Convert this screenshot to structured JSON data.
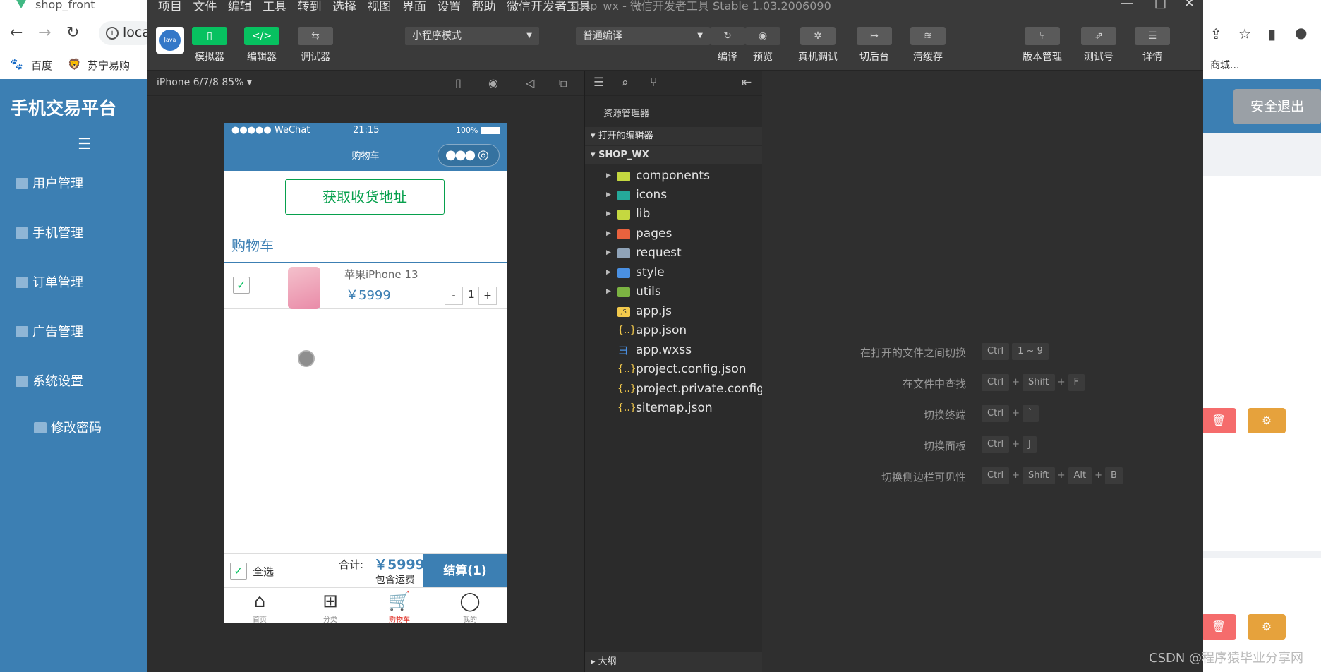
{
  "browser": {
    "tab_title": "shop_front",
    "address": "loca",
    "bookmarks": [
      "百度",
      "苏宁易购"
    ],
    "right_bookmark": "商城..."
  },
  "admin": {
    "title": "手机交易平台",
    "menu": [
      "用户管理",
      "手机管理",
      "订单管理",
      "广告管理",
      "系统设置"
    ],
    "submenu": "修改密码",
    "logout": "安全退出"
  },
  "devtools": {
    "menu": [
      "项目",
      "文件",
      "编辑",
      "工具",
      "转到",
      "选择",
      "视图",
      "界面",
      "设置",
      "帮助",
      "微信开发者工具"
    ],
    "window_title": "shop_wx - 微信开发者工具 Stable 1.03.2006090",
    "toolbar_left": [
      "模拟器",
      "编辑器",
      "调试器"
    ],
    "mode_select": "小程序模式",
    "compile_select": "普通编译",
    "toolbar_right": [
      "编译",
      "预览",
      "真机调试",
      "切后台",
      "清缓存",
      "版本管理",
      "测试号",
      "详情"
    ],
    "avatar_text": "Java"
  },
  "simulator": {
    "device": "iPhone 6/7/8 85%",
    "status_carrier": "●●●●● WeChat",
    "status_time": "21:15",
    "status_battery": "100%",
    "nav_title": "购物车",
    "address_button": "获取收货地址",
    "section_title": "购物车",
    "item_name": "苹果iPhone 13",
    "item_price": "￥5999",
    "qty_minus": "-",
    "qty": "1",
    "qty_plus": "+",
    "select_all": "全选",
    "total_label": "合计:",
    "total_value": "￥5999",
    "shipping": "包含运费",
    "checkout": "结算(1)",
    "tabs": [
      "首页",
      "分类",
      "购物车",
      "我的"
    ]
  },
  "explorer": {
    "title": "资源管理器",
    "open_editors": "打开的编辑器",
    "project": "SHOP_WX",
    "folders": [
      {
        "name": "components",
        "color": "#c5d840"
      },
      {
        "name": "icons",
        "color": "#25a99a"
      },
      {
        "name": "lib",
        "color": "#c5d840"
      },
      {
        "name": "pages",
        "color": "#e9623e"
      },
      {
        "name": "request",
        "color": "#8fa3b8"
      },
      {
        "name": "style",
        "color": "#4a90e2"
      },
      {
        "name": "utils",
        "color": "#7cb342"
      }
    ],
    "files": [
      "app.js",
      "app.json",
      "app.wxss",
      "project.config.json",
      "project.private.config...",
      "sitemap.json"
    ],
    "outline": "大纲"
  },
  "shortcuts": [
    {
      "label": "在打开的文件之间切换",
      "keys": [
        "Ctrl",
        "1 ~ 9"
      ]
    },
    {
      "label": "在文件中查找",
      "keys": [
        "Ctrl",
        "+",
        "Shift",
        "+",
        "F"
      ]
    },
    {
      "label": "切换终端",
      "keys": [
        "Ctrl",
        "+",
        "`"
      ]
    },
    {
      "label": "切换面板",
      "keys": [
        "Ctrl",
        "+",
        "J"
      ]
    },
    {
      "label": "切换侧边栏可见性",
      "keys": [
        "Ctrl",
        "+",
        "Shift",
        "+",
        "Alt",
        "+",
        "B"
      ]
    }
  ],
  "watermark": "CSDN @程序猿毕业分享网"
}
